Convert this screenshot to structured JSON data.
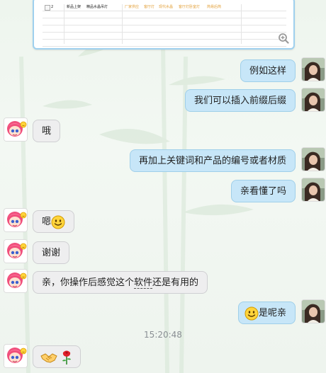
{
  "screenshot_card": {
    "row_number": "2",
    "cell_1": "新品上架",
    "cell_2": "精品水晶吊灯",
    "cell_3": "厂家供应",
    "cell_4": "客厅灯",
    "cell_5": "现代水晶",
    "cell_6": "客厅灯卧室灯",
    "cell_7": "简易后简"
  },
  "messages": [
    {
      "sender": "me",
      "text": "例如这样"
    },
    {
      "sender": "me",
      "text": "我们可以插入前缀后缀"
    },
    {
      "sender": "peer",
      "text": "哦"
    },
    {
      "sender": "me",
      "text": "再加上关键词和产品的编号或者材质"
    },
    {
      "sender": "me",
      "text": "亲看懂了吗"
    },
    {
      "sender": "peer",
      "text": "嗯",
      "emoji": "smile-emoji"
    },
    {
      "sender": "peer",
      "text": "谢谢"
    },
    {
      "sender": "peer",
      "text_before": "亲，你操作后感觉这个",
      "text_underlined": "软件",
      "text_after": "还是有用的"
    },
    {
      "sender": "me",
      "text": "是呢亲",
      "emoji": "smile-emoji"
    },
    {
      "sender": "peer",
      "emojis": [
        "handshake-emoji",
        "rose-emoji"
      ]
    }
  ],
  "timestamp": "15:20:48",
  "colors": {
    "my_bubble": "#c7e6f8",
    "peer_bubble": "#eeeeef",
    "card_border": "#9fd0ee"
  }
}
